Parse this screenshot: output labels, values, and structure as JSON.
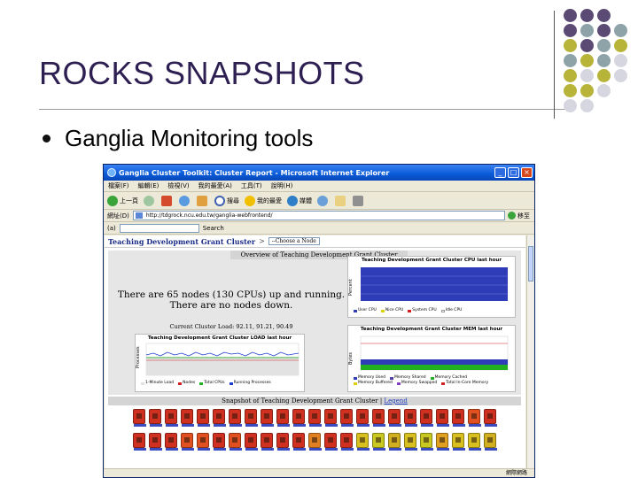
{
  "slide": {
    "title": "ROCKS SNAPSHOTS",
    "bullet": "Ganglia Monitoring tools",
    "decor_colors": {
      "dark_purple": "#5a4a74",
      "slate": "#8da3a8",
      "olive": "#b8b43a",
      "light_gray": "#d6d6e0"
    }
  },
  "browser": {
    "window_title": "Ganglia Cluster Toolkit: Cluster Report - Microsoft Internet Explorer",
    "menu": [
      "檔案(F)",
      "編輯(E)",
      "檢視(V)",
      "我的最愛(A)",
      "工具(T)",
      "說明(H)"
    ],
    "toolbar": {
      "back": "上一頁",
      "search": "搜尋",
      "favorites": "我的最愛",
      "media": "媒體"
    },
    "address_label": "網址(D)",
    "address": "http://tdgrock.ncu.edu.tw/ganglia-webfrontend/",
    "go": "移至",
    "links_label": "(a)",
    "search_label": "Search",
    "status": "網際網路"
  },
  "ganglia": {
    "cluster_title": "Teaching Development Grant Cluster",
    "separator": ">",
    "select_value": "--Choose a Node",
    "overview_header": "Overview of Teaching Development Grant Cluster",
    "nodes_up": "There are 65 nodes (130 CPUs) up and running.",
    "nodes_down": "There are no nodes down.",
    "current_load": "Current Cluster Load: 92.11, 91.21, 90.49",
    "load_graph": {
      "title": "Teaching Development Grant Cluster LOAD last hour",
      "ylabel": "Processes",
      "legend": [
        "1-Minute Load",
        "Nodes",
        "Total CPUs",
        "Running Processes"
      ]
    },
    "cpu_graph": {
      "title": "Teaching Development Grant Cluster CPU last hour",
      "ylabel": "Percent",
      "legend": [
        "User CPU",
        "Nice CPU",
        "System CPU",
        "Idle CPU"
      ]
    },
    "mem_graph": {
      "title": "Teaching Development Grant Cluster MEM last hour",
      "ylabel": "Bytes",
      "legend": [
        "Memory Used",
        "Memory Shared",
        "Memory Cached",
        "Memory Buffered",
        "Memory Swapped",
        "Total In-Core Memory"
      ]
    },
    "snapshot_header": "Snapshot of Teaching Development Grant Cluster",
    "legend_link": "Legend"
  }
}
